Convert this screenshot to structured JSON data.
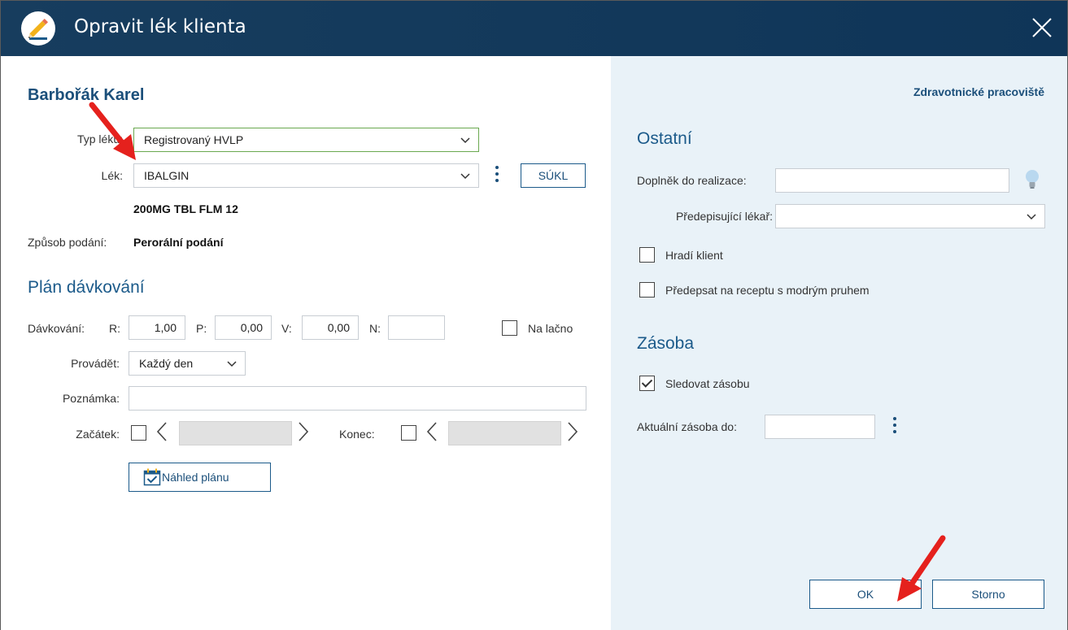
{
  "window": {
    "title": "Opravit lék klienta",
    "title_icon": "pencil-icon",
    "close_icon": "close-icon"
  },
  "left": {
    "client_name": "Barbořák Karel",
    "typ_leku": {
      "label": "Typ léku:",
      "value": "Registrovaný HVLP"
    },
    "lek": {
      "label": "Lék:",
      "value": "IBALGIN",
      "detail": "200MG TBL FLM 12",
      "sukl_button": "SÚKL"
    },
    "zpusob_podani": {
      "label": "Způsob podání:",
      "value": "Perorální podání"
    },
    "plan_title": "Plán dávkování",
    "davkovani": {
      "label": "Dávkování:",
      "r_label": "R:",
      "r_value": "1,00",
      "p_label": "P:",
      "p_value": "0,00",
      "v_label": "V:",
      "v_value": "0,00",
      "n_label": "N:",
      "n_value": "",
      "na_lacno_label": "Na lačno",
      "na_lacno_checked": false
    },
    "provadet": {
      "label": "Provádět:",
      "value": "Každý den"
    },
    "poznamka": {
      "label": "Poznámka:",
      "value": ""
    },
    "zacatek": {
      "label": "Začátek:",
      "checked": false,
      "value": ""
    },
    "konec": {
      "label": "Konec:",
      "checked": false,
      "value": ""
    },
    "nahled_button": "Náhled plánu"
  },
  "right": {
    "workplace_link": "Zdravotnické pracoviště",
    "ostatni_title": "Ostatní",
    "doplnek": {
      "label": "Doplněk do realizace:",
      "value": ""
    },
    "predepisujici": {
      "label": "Předepisující lékař:",
      "value": ""
    },
    "hradi_klient": {
      "label": "Hradí klient",
      "checked": false
    },
    "modry_pruh": {
      "label": "Předepsat na receptu s modrým pruhem",
      "checked": false
    },
    "zasoba_title": "Zásoba",
    "sledovat": {
      "label": "Sledovat zásobu",
      "checked": true
    },
    "aktualni": {
      "label": "Aktuální zásoba do:",
      "value": ""
    }
  },
  "footer": {
    "ok": "OK",
    "cancel": "Storno"
  },
  "colors": {
    "titlebar": "#173d5e",
    "accent": "#1b5a8a",
    "right_panel": "#e9f2f8",
    "annotation": "#e5211d"
  }
}
